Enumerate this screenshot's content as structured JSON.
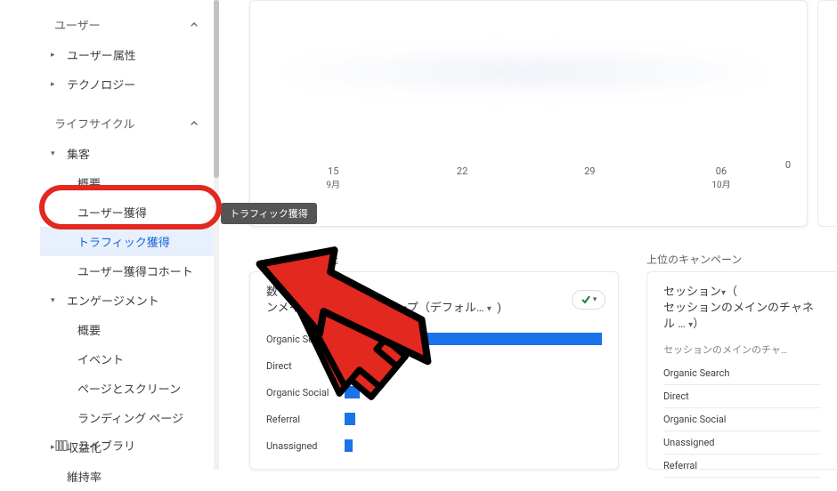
{
  "sidebar": {
    "sections": {
      "user": {
        "label": "ユーザー"
      },
      "lifecycle": {
        "label": "ライフサイクル"
      }
    },
    "userAttributes": "ユーザー属性",
    "technology": "テクノロジー",
    "acquisition": {
      "label": "集客",
      "overview": "概要",
      "userAcq": "ユーザー獲得",
      "trafficAcq": "トラフィック獲得",
      "userAcqCohort": "ユーザー獲得コホート"
    },
    "engagement": {
      "label": "エンゲージメント",
      "overview": "概要",
      "events": "イベント",
      "pagesScreens": "ページとスクリーン",
      "landingPages": "ランディング ページ"
    },
    "monetization": "収益化",
    "retention": "維持率",
    "library": "ライブラリ"
  },
  "tooltip": "トラフィック獲得",
  "topChart": {
    "ticks": [
      {
        "d": "15",
        "m": "9月"
      },
      {
        "d": "22",
        "m": ""
      },
      {
        "d": "29",
        "m": ""
      },
      {
        "d": "06",
        "m": "10月"
      }
    ],
    "yZero": "0"
  },
  "panelTitles": {
    "left": "ーの参照元",
    "right": "上位のキャンペーン"
  },
  "leftPanel": {
    "metric": "数（",
    "dimension": "ンメインのチャネル グループ（デフォル…",
    "dd": "▾"
  },
  "rightPanel": {
    "metric": "セッション",
    "dimension": "セッションのメインのチャネル …",
    "sub": "セッションのメインのチャ…",
    "dd": "▾"
  },
  "chart_data": {
    "type": "bar",
    "title": "セッション数（セッションのメインのチャネル グループ（デフォルト））",
    "categories": [
      "Organic Search",
      "Direct",
      "Organic Social",
      "Referral",
      "Unassigned"
    ],
    "values": [
      100,
      9,
      6,
      4,
      3
    ],
    "orientation": "horizontal",
    "xlabel": "",
    "ylabel": ""
  },
  "rightList": [
    "Organic Search",
    "Direct",
    "Organic Social",
    "Unassigned",
    "Referral"
  ]
}
